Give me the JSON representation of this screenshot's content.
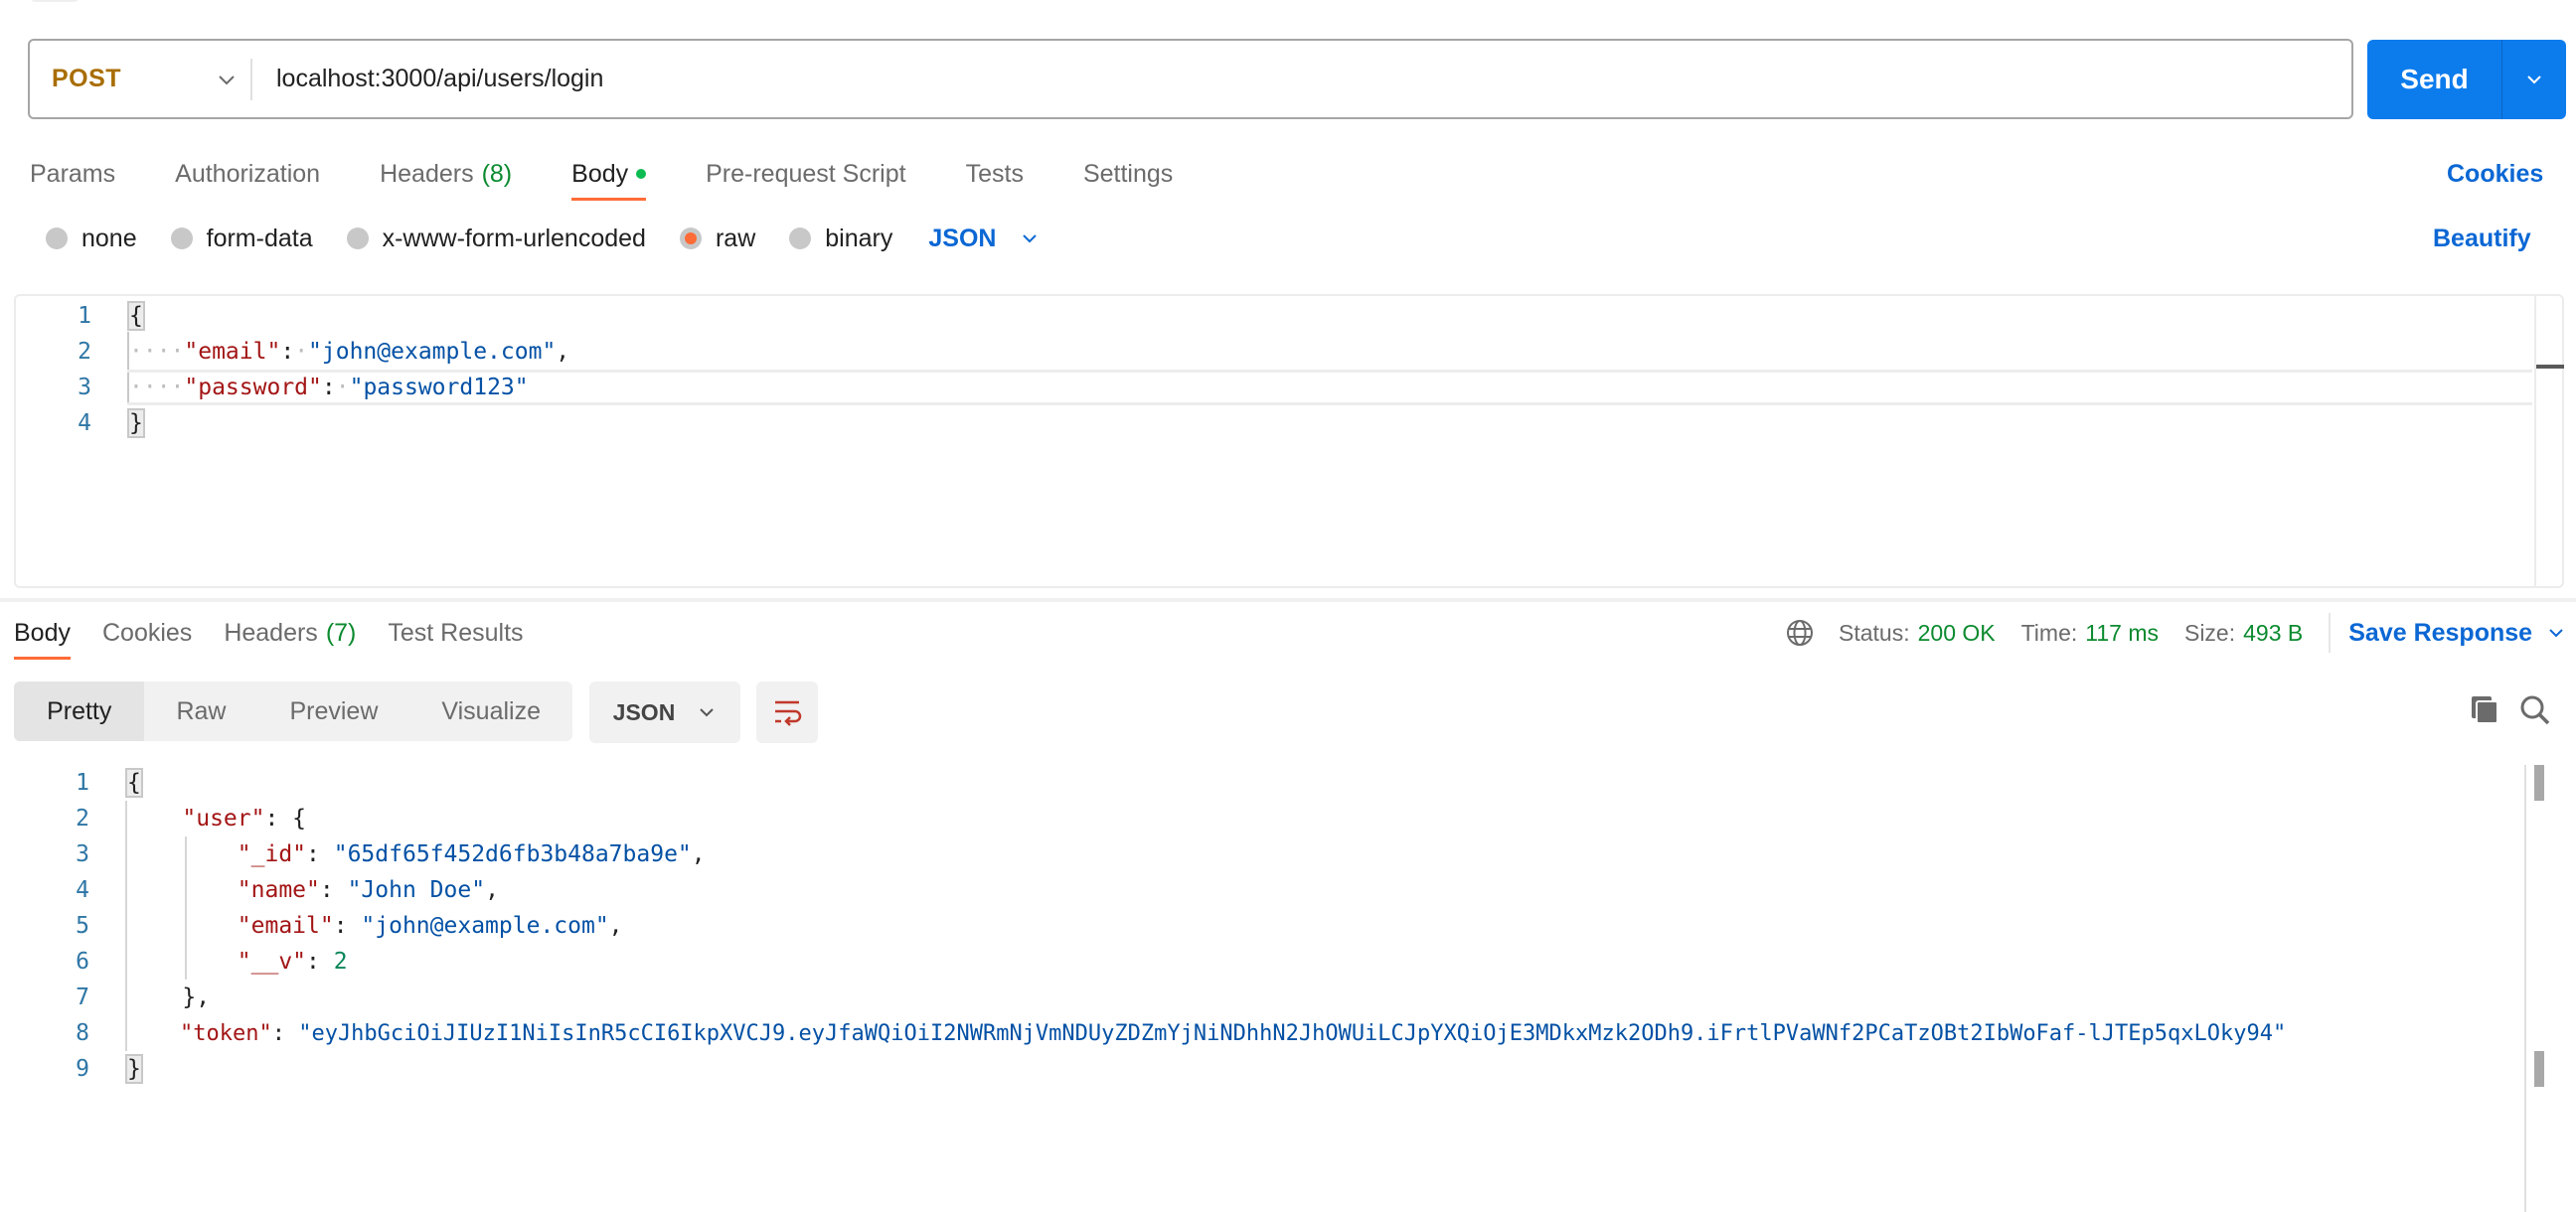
{
  "request": {
    "method": "POST",
    "url": "localhost:3000/api/users/login",
    "send_label": "Send",
    "tabs": [
      {
        "label": "Params"
      },
      {
        "label": "Authorization"
      },
      {
        "label": "Headers",
        "count": "(8)"
      },
      {
        "label": "Body",
        "active": true,
        "indicator": "green-dot"
      },
      {
        "label": "Pre-request Script"
      },
      {
        "label": "Tests"
      },
      {
        "label": "Settings"
      }
    ],
    "cookies_label": "Cookies",
    "body_types": [
      {
        "label": "none",
        "checked": false
      },
      {
        "label": "form-data",
        "checked": false
      },
      {
        "label": "x-www-form-urlencoded",
        "checked": false
      },
      {
        "label": "raw",
        "checked": true
      },
      {
        "label": "binary",
        "checked": false
      }
    ],
    "body_language": "JSON",
    "beautify_label": "Beautify",
    "body_lines": [
      {
        "n": "1",
        "text": "{"
      },
      {
        "n": "2",
        "key": "\"email\"",
        "value": "\"john@example.com\"",
        "trail": ","
      },
      {
        "n": "3",
        "key": "\"password\"",
        "value": "\"password123\"",
        "trail": ""
      },
      {
        "n": "4",
        "text": "}"
      }
    ]
  },
  "response": {
    "tabs": [
      {
        "label": "Body",
        "active": true
      },
      {
        "label": "Cookies"
      },
      {
        "label": "Headers",
        "count": "(7)"
      },
      {
        "label": "Test Results"
      }
    ],
    "status_label": "Status:",
    "status_value": "200 OK",
    "time_label": "Time:",
    "time_value": "117 ms",
    "size_label": "Size:",
    "size_value": "493 B",
    "save_label": "Save Response",
    "view_modes": [
      "Pretty",
      "Raw",
      "Preview",
      "Visualize"
    ],
    "active_view": "Pretty",
    "language": "JSON",
    "line_numbers": [
      "1",
      "2",
      "3",
      "4",
      "5",
      "6",
      "7",
      "8",
      "9"
    ],
    "body": {
      "user_key": "\"user\"",
      "id_key": "\"_id\"",
      "id_value": "\"65df65f452d6fb3b48a7ba9e\"",
      "name_key": "\"name\"",
      "name_value": "\"John Doe\"",
      "email_key": "\"email\"",
      "email_value": "\"john@example.com\"",
      "v_key": "\"__v\"",
      "v_value": "2",
      "token_key": "\"token\"",
      "token_value": "\"eyJhbGciOiJIUzI1NiIsInR5cCI6IkpXVCJ9.eyJfaWQiOiI2NWRmNjVmNDUyZDZmYjNiNDhhN2JhOWUiLCJpYXQiOjE3MDkxMzk2ODh9.iFrtlPVaWNf2PCaTzOBt2IbWoFaf-lJTEp5qxLOky94\""
    }
  },
  "colors": {
    "accent": "#0c7ced",
    "link": "#0b67d4",
    "method_post": "#a86d00",
    "active_tab_underline": "#ff6c37",
    "success": "#0b8a2f"
  }
}
